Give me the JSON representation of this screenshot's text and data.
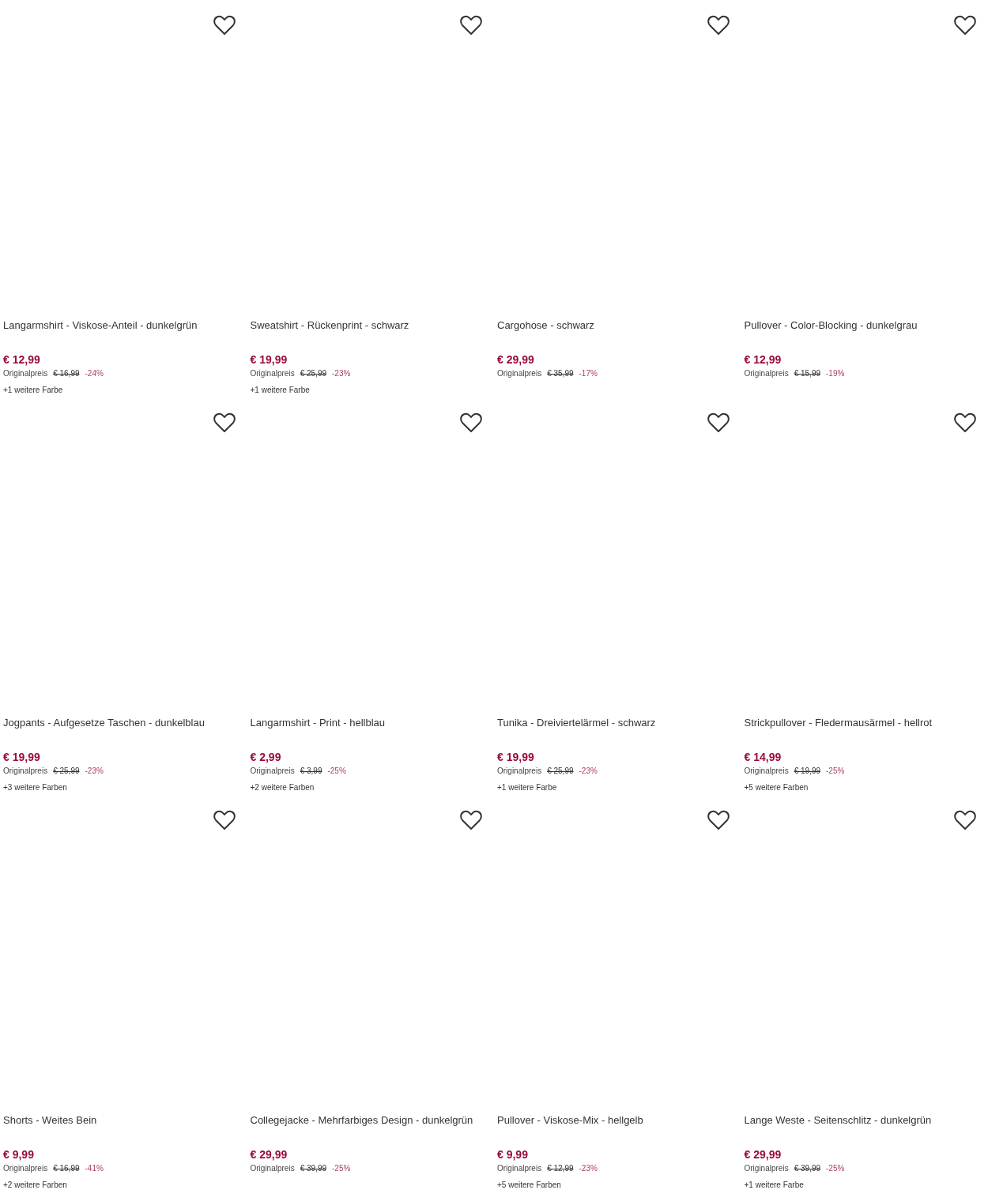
{
  "products": [
    {
      "title": "Langarmshirt - Viskose-Anteil - dunkelgrün",
      "price": "€ 12,99",
      "original_label": "Originalpreis",
      "original_price": "€ 16,99",
      "discount": "-24%",
      "more_colors": "+1 weitere Farbe"
    },
    {
      "title": "Sweatshirt - Rückenprint - schwarz",
      "price": "€ 19,99",
      "original_label": "Originalpreis",
      "original_price": "€ 25,99",
      "discount": "-23%",
      "more_colors": "+1 weitere Farbe"
    },
    {
      "title": "Cargohose - schwarz",
      "price": "€ 29,99",
      "original_label": "Originalpreis",
      "original_price": "€ 35,99",
      "discount": "-17%"
    },
    {
      "title": "Pullover - Color-Blocking - dunkelgrau",
      "price": "€ 12,99",
      "original_label": "Originalpreis",
      "original_price": "€ 15,99",
      "discount": "-19%"
    },
    {
      "title": "Jogpants - Aufgesetze Taschen - dunkelblau",
      "price": "€ 19,99",
      "original_label": "Originalpreis",
      "original_price": "€ 25,99",
      "discount": "-23%",
      "more_colors": "+3 weitere Farben"
    },
    {
      "title": "Langarmshirt - Print - hellblau",
      "price": "€ 2,99",
      "original_label": "Originalpreis",
      "original_price": "€ 3,99",
      "discount": "-25%",
      "more_colors": "+2 weitere Farben"
    },
    {
      "title": "Tunika - Dreiviertelärmel - schwarz",
      "price": "€ 19,99",
      "original_label": "Originalpreis",
      "original_price": "€ 25,99",
      "discount": "-23%",
      "more_colors": "+1 weitere Farbe"
    },
    {
      "title": "Strickpullover - Fledermausärmel - hellrot",
      "price": "€ 14,99",
      "original_label": "Originalpreis",
      "original_price": "€ 19,99",
      "discount": "-25%",
      "more_colors": "+5 weitere Farben"
    },
    {
      "title": "Shorts - Weites Bein",
      "price": "€ 9,99",
      "original_label": "Originalpreis",
      "original_price": "€ 16,99",
      "discount": "-41%",
      "more_colors": "+2 weitere Farben"
    },
    {
      "title": "Collegejacke - Mehrfarbiges Design - dunkelgrün",
      "price": "€ 29,99",
      "original_label": "Originalpreis",
      "original_price": "€ 39,99",
      "discount": "-25%"
    },
    {
      "title": "Pullover - Viskose-Mix - hellgelb",
      "price": "€ 9,99",
      "original_label": "Originalpreis",
      "original_price": "€ 12,99",
      "discount": "-23%",
      "more_colors": "+5 weitere Farben"
    },
    {
      "title": "Lange Weste - Seitenschlitz - dunkelgrün",
      "price": "€ 29,99",
      "original_label": "Originalpreis",
      "original_price": "€ 39,99",
      "discount": "-25%",
      "more_colors": "+1 weitere Farbe"
    }
  ]
}
